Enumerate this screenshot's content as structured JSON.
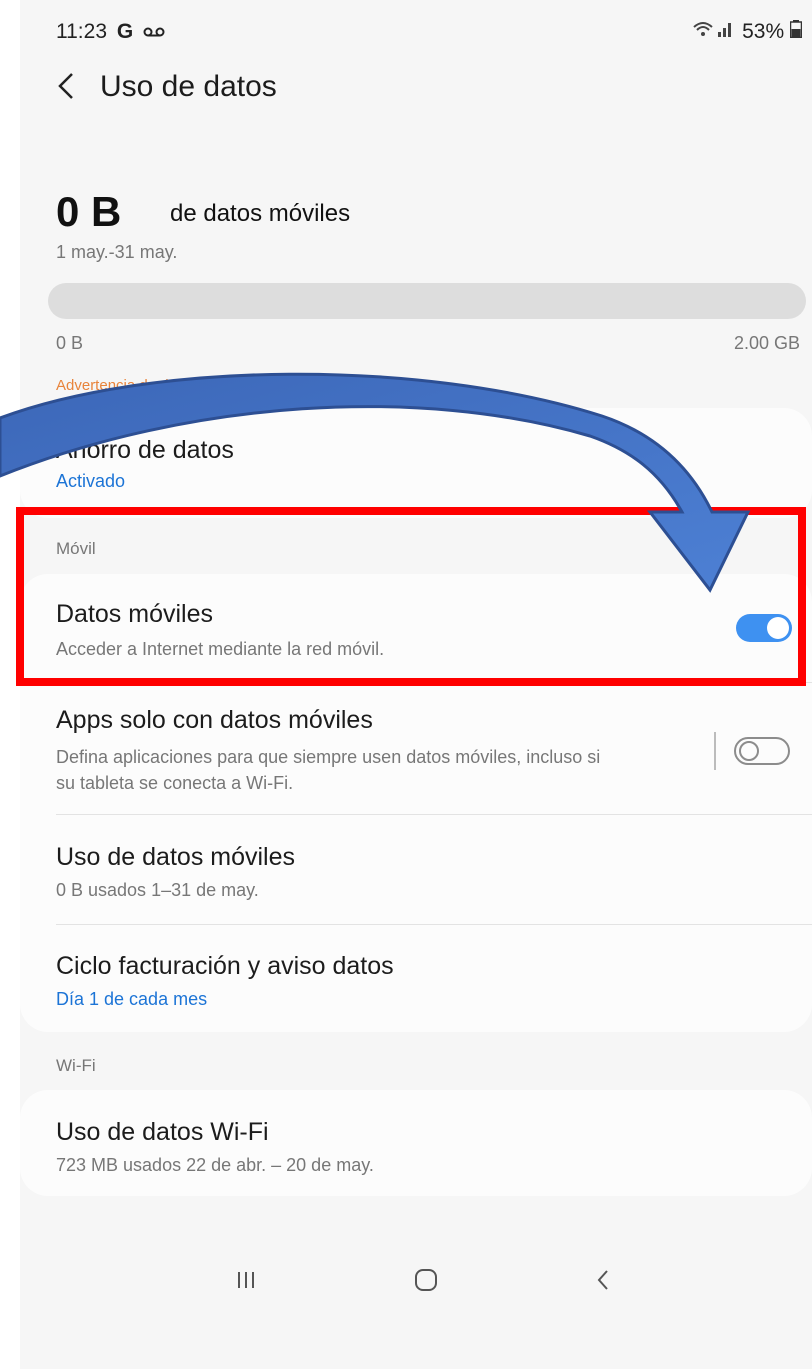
{
  "status_bar": {
    "time": "11:23",
    "carrier_icon": "G",
    "voicemail_icon": "voicemail-icon",
    "signal": "wifi-signal-icon",
    "battery": "53%"
  },
  "header": {
    "back_icon": "chevron-left-icon",
    "title": "Uso de datos"
  },
  "usage": {
    "amount": "0 B",
    "unit_label": "de datos móviles",
    "period": "1 may.-31 may.",
    "progress_fraction": 0,
    "min_label": "0 B",
    "max_label": "2.00 GB",
    "warning": "Advertencia de datos: 2.00 GB"
  },
  "data_saver": {
    "title": "Ahorro de datos",
    "status": "Activado"
  },
  "mobile_section": {
    "label": "Móvil",
    "items": [
      {
        "title": "Datos móviles",
        "subtitle": "Acceder a Internet mediante la red móvil.",
        "toggle": true
      },
      {
        "title": "Apps solo con datos móviles",
        "subtitle_line1": "Defina aplicaciones para que siempre usen datos móviles, incluso si",
        "subtitle_line2": "su tableta se conecta a Wi-Fi.",
        "toggle": false
      },
      {
        "title": "Uso de datos móviles",
        "subtitle": "0 B usados 1–31 de may."
      },
      {
        "title": "Ciclo facturación y aviso datos",
        "subtitle": "Día 1 de cada mes"
      }
    ]
  },
  "wifi_section": {
    "label": "Wi-Fi",
    "items": [
      {
        "title": "Uso de datos Wi-Fi",
        "subtitle": "723 MB usados 22 de abr. – 20 de may."
      }
    ]
  },
  "nav_bar": {
    "recents_icon": "recents-icon",
    "home_icon": "home-icon",
    "back_icon": "back-icon"
  },
  "colors": {
    "accent": "#3e91f1",
    "link": "#1c74d6",
    "warning": "#e8843b",
    "highlight_box": "#ff0000",
    "arrow": "#4472c4"
  }
}
